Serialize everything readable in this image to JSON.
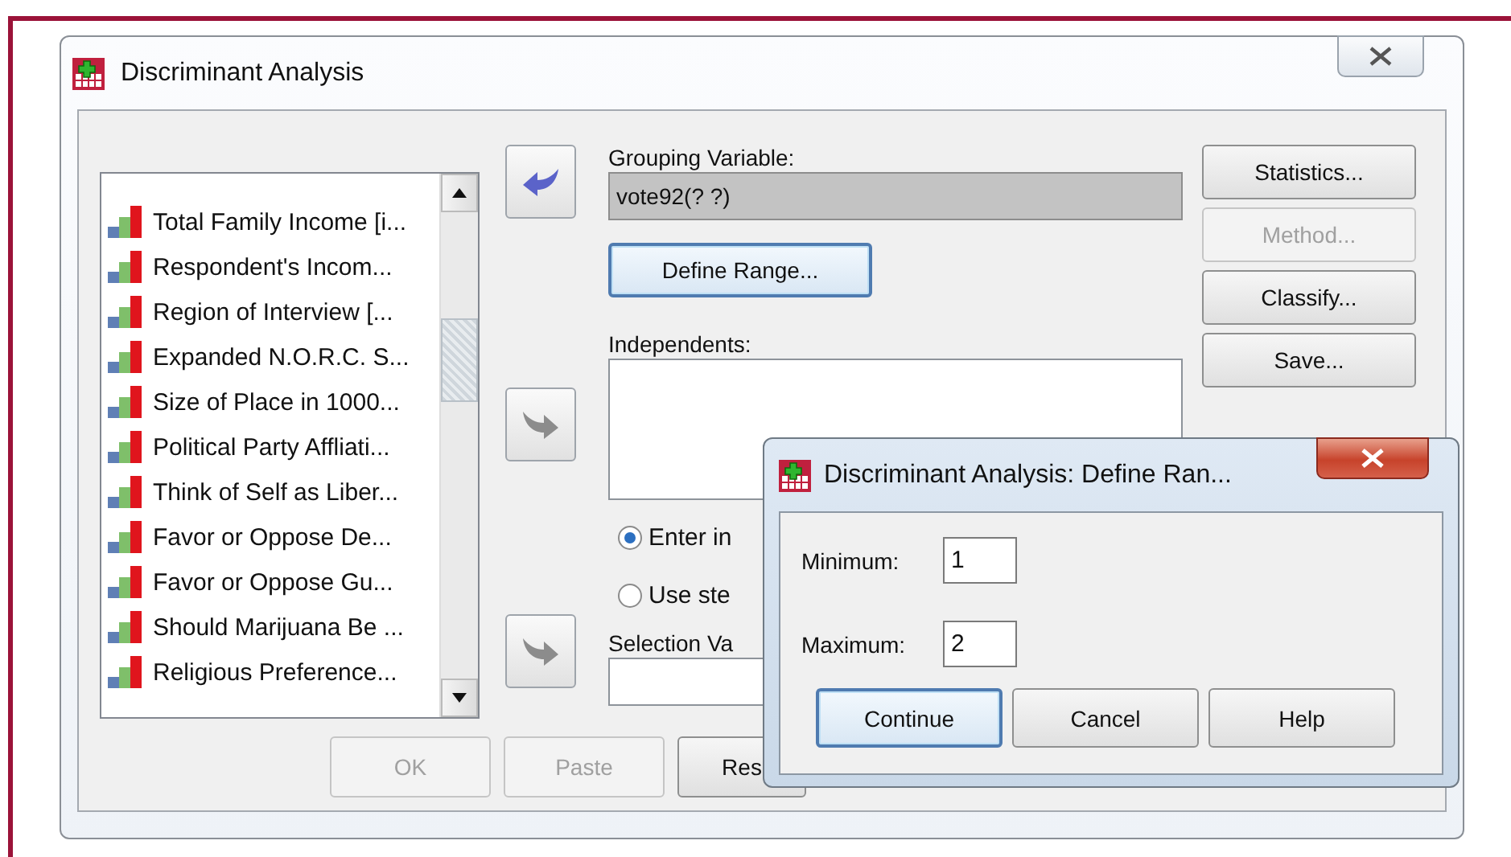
{
  "window": {
    "title": "Discriminant Analysis"
  },
  "variables": [
    "Total Family Income [i...",
    "Respondent's Incom...",
    "Region of Interview [...",
    "Expanded N.O.R.C. S...",
    "Size of Place in 1000...",
    "Political Party Affliati...",
    "Think of Self as Liber...",
    "Favor or Oppose De...",
    "Favor or Oppose Gu...",
    "Should Marijuana Be ...",
    "Religious Preference..."
  ],
  "arrow_buttons": [
    {
      "kind": "left",
      "disabled": false
    },
    {
      "kind": "right",
      "disabled": true
    },
    {
      "kind": "right",
      "disabled": true
    }
  ],
  "grouping": {
    "label": "Grouping Variable:",
    "value": "vote92(? ?)"
  },
  "define_range_button": {
    "label": "Define Range...",
    "default": true
  },
  "independents": {
    "label": "Independents:"
  },
  "methods": [
    {
      "label": "Enter in",
      "selected": true
    },
    {
      "label": "Use ste",
      "selected": false
    }
  ],
  "selection": {
    "label": "Selection Va"
  },
  "side_buttons": [
    {
      "label": "Statistics...",
      "disabled": false
    },
    {
      "label": "Method...",
      "disabled": true
    },
    {
      "label": "Classify...",
      "disabled": false
    },
    {
      "label": "Save...",
      "disabled": false
    }
  ],
  "bottom_buttons": [
    {
      "label": "OK",
      "disabled": true
    },
    {
      "label": "Paste",
      "disabled": true
    },
    {
      "label": "Res",
      "disabled": false
    }
  ],
  "define_range_dialog": {
    "title": "Discriminant Analysis: Define Ran...",
    "fields": [
      {
        "label": "Minimum:",
        "value": "1"
      },
      {
        "label": "Maximum:",
        "value": "2"
      }
    ],
    "buttons": [
      {
        "label": "Continue",
        "default": true
      },
      {
        "label": "Cancel",
        "default": false
      },
      {
        "label": "Help",
        "default": false
      }
    ]
  }
}
